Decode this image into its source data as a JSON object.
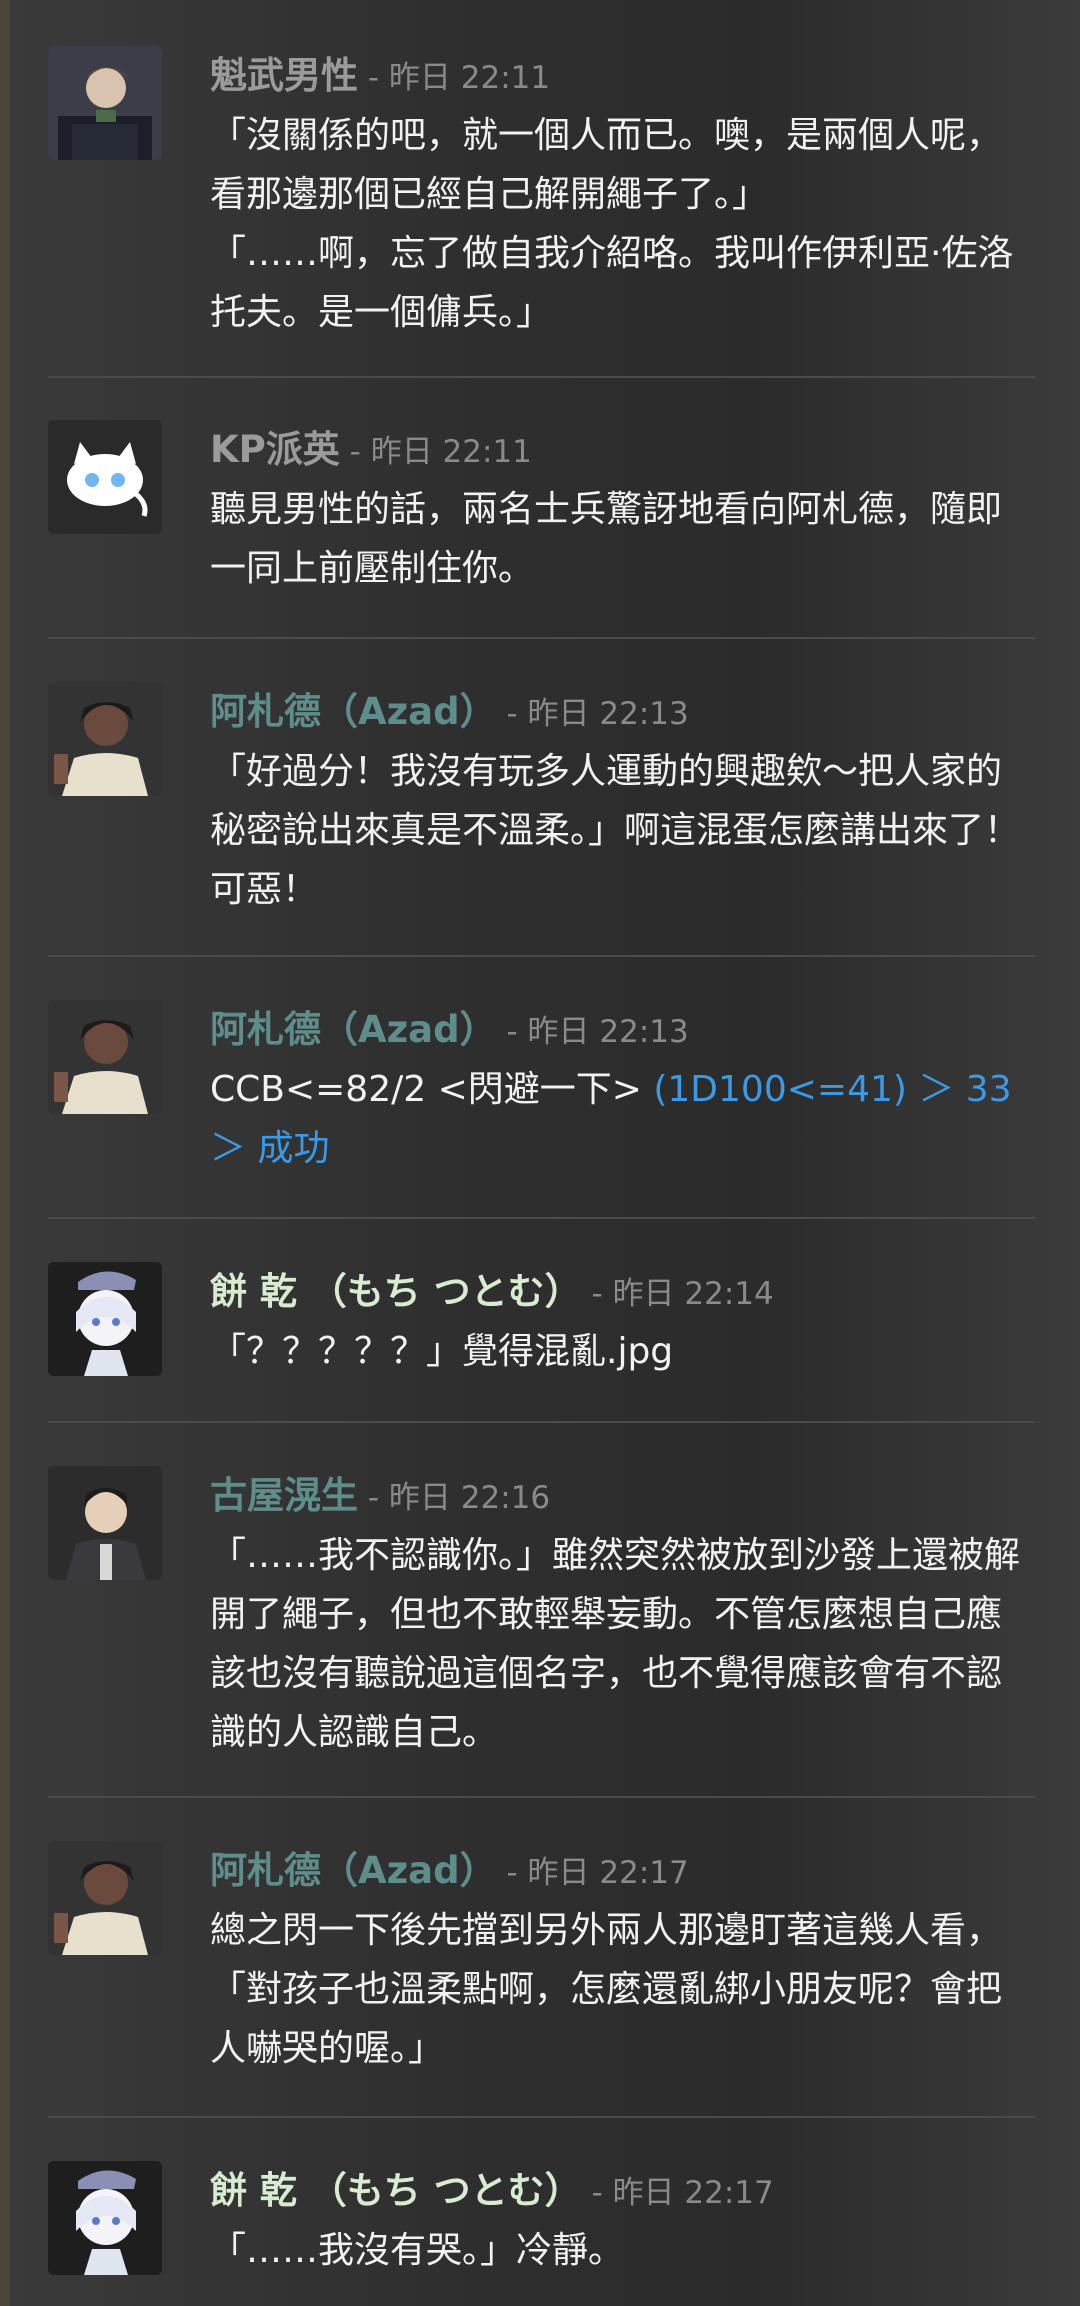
{
  "colors": {
    "author_brown": "#a8a8a8",
    "author_azad": "#5e8e8c",
    "author_mochi": "#d8ecd0",
    "author_koya": "#5e8e8c",
    "timestamp": "#8a8a8a",
    "roll": "#3a9ae8",
    "text": "#f2f2f2"
  },
  "messages": [
    {
      "author": "魁武男性",
      "author_color": "#9b9b9b",
      "separator": " - ",
      "timestamp": "昨日 22:11",
      "avatar_icon": "soldier-avatar-icon",
      "lines": [
        "「沒關係的吧，就一個人而已。噢，是兩個人呢，看那邊那個已經自己解開繩子了。」",
        "「……啊，忘了做自我介紹咯。我叫作伊利亞·佐洛托夫。是一個傭兵。」"
      ]
    },
    {
      "author": "KP派英",
      "author_color": "#9b9b9b",
      "separator": " - ",
      "timestamp": "昨日 22:11",
      "avatar_icon": "white-cat-avatar-icon",
      "lines": [
        "聽見男性的話，兩名士兵驚訝地看向阿札德，隨即一同上前壓制住你。"
      ]
    },
    {
      "author": "阿札德（Azad）",
      "author_color": "#5e8e8c",
      "separator": " - ",
      "timestamp": "昨日 22:13",
      "avatar_icon": "azad-avatar-icon",
      "lines": [
        "「好過分！我沒有玩多人運動的興趣欸～把人家的秘密說出來真是不溫柔。」啊這混蛋怎麼講出來了！可惡！"
      ]
    },
    {
      "author": "阿札德（Azad）",
      "author_color": "#5e8e8c",
      "separator": " - ",
      "timestamp": "昨日 22:13",
      "avatar_icon": "azad-avatar-icon",
      "text_plain": "CCB<=82/2 <閃避一下> ",
      "text_roll": "(1D100<=41) ＞ 33 ＞ 成功"
    },
    {
      "author": "餅 乾 （もち つとむ）",
      "author_color": "#d8ecd0",
      "separator": " - ",
      "timestamp": "昨日 22:14",
      "avatar_icon": "mochi-avatar-icon",
      "lines": [
        "「？？？？？」覺得混亂.jpg"
      ]
    },
    {
      "author": "古屋滉生",
      "author_color": "#5e8e8c",
      "separator": " - ",
      "timestamp": "昨日 22:16",
      "avatar_icon": "koya-avatar-icon",
      "lines": [
        "「……我不認識你。」雖然突然被放到沙發上還被解開了繩子，但也不敢輕舉妄動。不管怎麼想自己應該也沒有聽說過這個名字，也不覺得應該會有不認識的人認識自己。"
      ]
    },
    {
      "author": "阿札德（Azad）",
      "author_color": "#5e8e8c",
      "separator": " - ",
      "timestamp": "昨日 22:17",
      "avatar_icon": "azad-avatar-icon",
      "lines": [
        "總之閃一下後先擋到另外兩人那邊盯著這幾人看，「對孩子也溫柔點啊，怎麼還亂綁小朋友呢？會把人嚇哭的喔。」"
      ]
    },
    {
      "author": "餅 乾 （もち つとむ）",
      "author_color": "#d8ecd0",
      "separator": " - ",
      "timestamp": "昨日 22:17",
      "avatar_icon": "mochi-avatar-icon",
      "lines": [
        "「……我沒有哭。」冷靜。"
      ]
    }
  ]
}
